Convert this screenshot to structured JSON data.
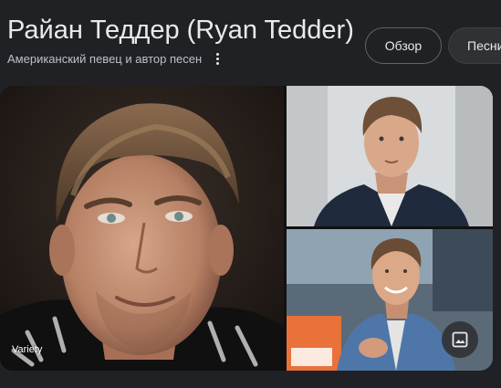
{
  "entity": {
    "title": "Райан Теддер (Ryan Tedder)",
    "subtitle": "Американский певец и автор песен"
  },
  "tabs": [
    {
      "label": "Обзор"
    },
    {
      "label": "Песни"
    }
  ],
  "gallery": {
    "main_source": "Variety"
  },
  "icons": {
    "more": "more-vert-icon",
    "image_search": "image-icon"
  }
}
